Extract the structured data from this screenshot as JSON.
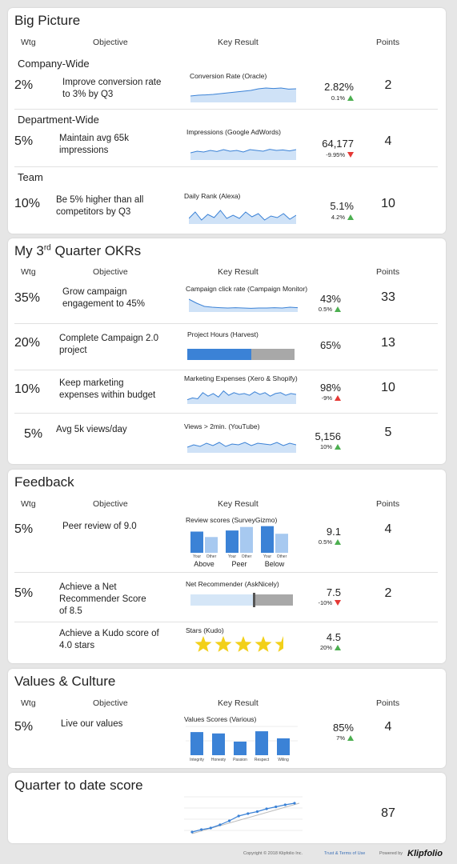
{
  "columns": {
    "wtg": "Wtg",
    "objective": "Objective",
    "key_result": "Key Result",
    "points": "Points"
  },
  "big_picture": {
    "title": "Big Picture",
    "rows": [
      {
        "group": "Company-Wide",
        "wtg": "2%",
        "objective_line1": "Improve conversion rate",
        "objective_line2": "to 3% by Q3",
        "kr_label": "Conversion Rate (Oracle)",
        "value": "2.82%",
        "change": "0.1%",
        "direction": "up",
        "points": "2"
      },
      {
        "group": "Department-Wide",
        "wtg": "5%",
        "objective_line1": "Maintain avg 65k",
        "objective_line2": "impressions",
        "kr_label": "Impressions (Google AdWords)",
        "value": "64,177",
        "change": "-9.95%",
        "direction": "down",
        "points": "4"
      },
      {
        "group": "Team",
        "wtg": "10%",
        "objective_line1": "Be 5% higher than all",
        "objective_line2": "competitors by Q3",
        "kr_label": "Daily Rank (Alexa)",
        "value": "5.1%",
        "change": "4.2%",
        "direction": "up",
        "points": "10"
      }
    ]
  },
  "q3_okrs": {
    "title_main": "My 3",
    "title_sup": "rd",
    "title_rest": " Quarter OKRs",
    "rows": [
      {
        "wtg": "35%",
        "objective_line1": "Grow campaign",
        "objective_line2": "engagement to 45%",
        "kr_label": "Campaign click rate (Campaign Monitor)",
        "value": "43%",
        "change": "0.5%",
        "direction": "up",
        "points": "33"
      },
      {
        "wtg": "20%",
        "objective_line1": "Complete Campaign 2.0",
        "objective_line2": "project",
        "kr_label": "Project Hours (Harvest)",
        "value": "65%",
        "progress": 0.6,
        "points": "13"
      },
      {
        "wtg": "10%",
        "objective_line1": "Keep marketing",
        "objective_line2": "expenses within budget",
        "kr_label": "Marketing Expenses (Xero & Shopify)",
        "value": "98%",
        "change": "-9%",
        "direction": "up-red",
        "points": "10"
      },
      {
        "wtg": "5%",
        "objective_line1": "Avg 5k views/day",
        "objective_line2": "",
        "kr_label": "Views > 2min. (YouTube)",
        "value": "5,156",
        "change": "10%",
        "direction": "up",
        "points": "5"
      }
    ]
  },
  "feedback": {
    "title": "Feedback",
    "rows": [
      {
        "wtg": "5%",
        "objective_line1": "Peer review of 9.0",
        "kr_label": "Review scores (SurveyGizmo)",
        "groups": [
          "Above",
          "Peer",
          "Below"
        ],
        "bar_labels": [
          "Your",
          "Other"
        ],
        "bars": [
          {
            "your": 0.78,
            "other": 0.58
          },
          {
            "your": 0.82,
            "other": 0.95
          },
          {
            "your": 0.98,
            "other": 0.7
          }
        ],
        "value": "9.1",
        "change": "0.5%",
        "direction": "up",
        "points": "4"
      },
      {
        "wtg": "5%",
        "objective_line1": "Achieve a Net",
        "objective_line2": "Recommender Score",
        "objective_line3": "of 8.5",
        "kr_label": "Net Recommender (AskNicely)",
        "progress": 0.62,
        "value": "7.5",
        "change": "-10%",
        "direction": "down",
        "points": "2"
      },
      {
        "wtg": "",
        "objective_line1": "Achieve a Kudo score of",
        "objective_line2": "4.0 stars",
        "kr_label": "Stars (Kudo)",
        "stars": 4.5,
        "value": "4.5",
        "change": "20%",
        "direction": "up",
        "points": ""
      }
    ]
  },
  "values_culture": {
    "title": "Values & Culture",
    "row": {
      "wtg": "5%",
      "objective_line1": "Live our values",
      "kr_label": "Values Scores (Various)",
      "categories": [
        "Integrity",
        "Honesty",
        "Passion",
        "Respect",
        "Wiling"
      ],
      "values": [
        0.85,
        0.8,
        0.5,
        0.88,
        0.62
      ],
      "value": "85%",
      "change": "7%",
      "direction": "up",
      "points": "4"
    }
  },
  "qtd": {
    "title": "Quarter to date score",
    "series": [
      12,
      18,
      22,
      30,
      40,
      52,
      58,
      63,
      70,
      75,
      80,
      84
    ],
    "trend": [
      8,
      84
    ],
    "score": "87"
  },
  "footer": {
    "copyright": "Copyright © 2018 Klipfolio Inc.",
    "trust": "Trust & Terms of Use",
    "powered": "Powered by",
    "brand": "Klipfolio"
  },
  "colors": {
    "accent": "#3b82d6",
    "accent_light": "#a7c9f0",
    "spark_fill": "#cfe2f7",
    "up": "#4caf50",
    "down": "#e53935",
    "star": "#f2d019",
    "grey": "#a8a8a8"
  }
}
